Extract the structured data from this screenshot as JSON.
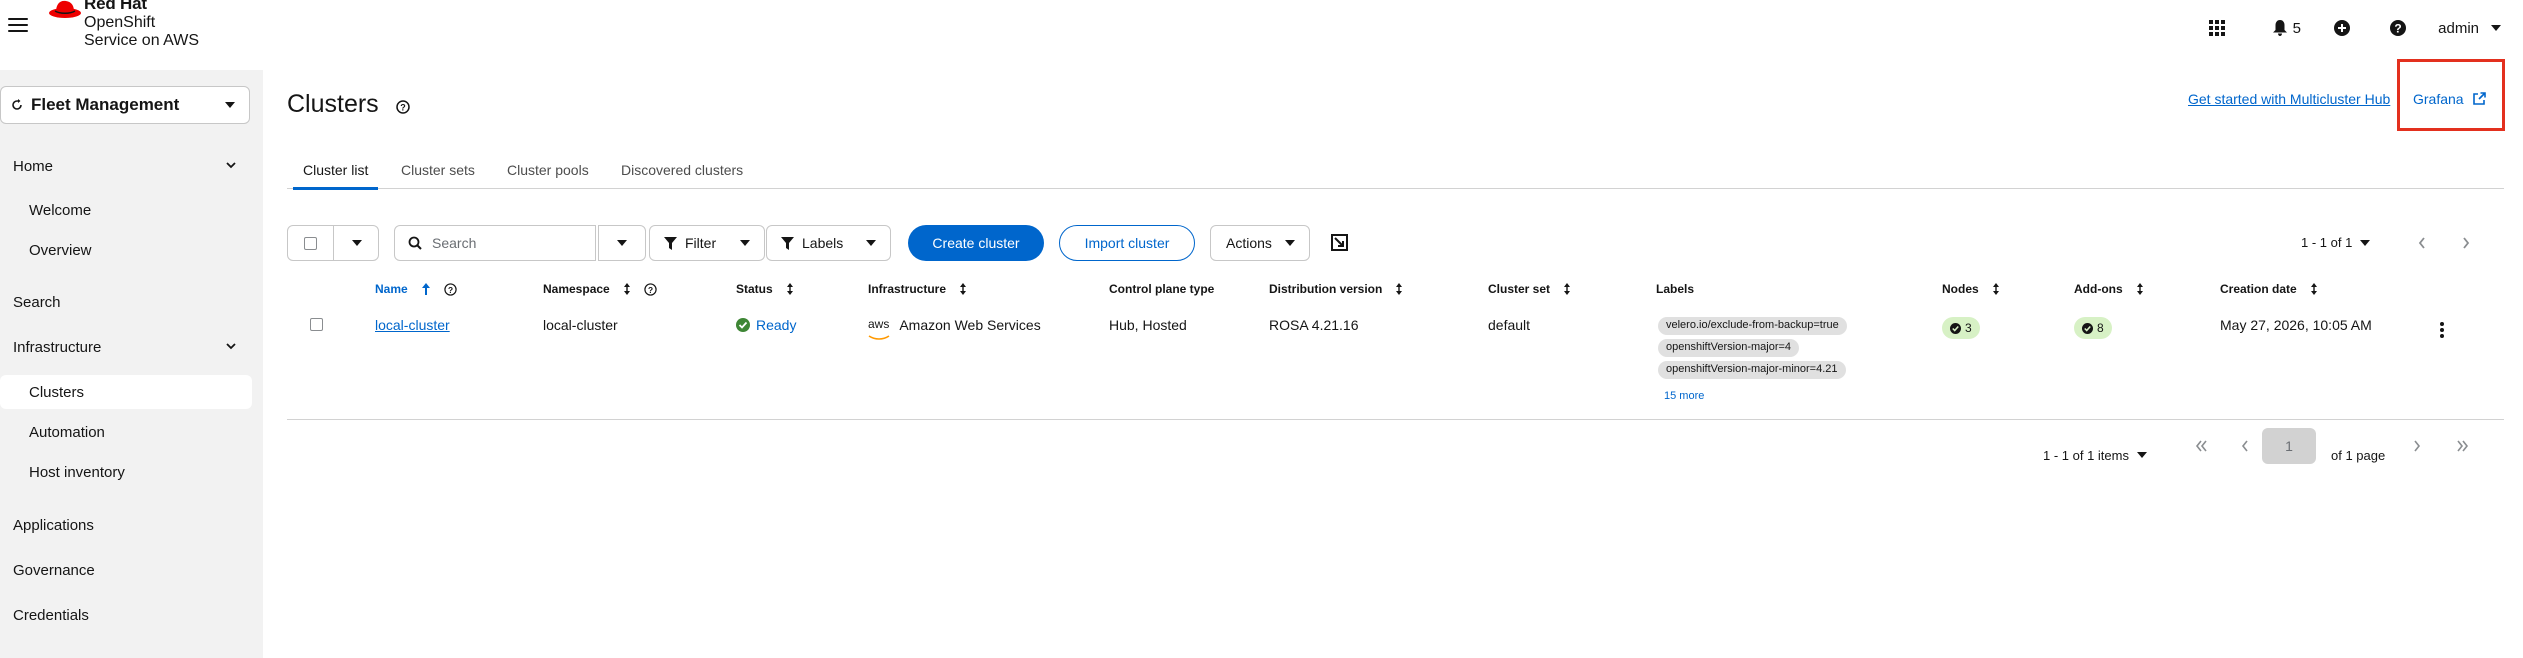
{
  "masthead": {
    "brand": "Red Hat",
    "product_line1": "OpenShift",
    "product_line2": "Service on AWS",
    "notifications_count": "5",
    "user": "admin",
    "icons": [
      "menu-icon",
      "app-launcher-icon",
      "bell-icon",
      "plus-circle-icon",
      "help-icon",
      "caret-down-icon"
    ]
  },
  "sidebar": {
    "perspective": "Fleet Management",
    "items": [
      {
        "label": "Home"
      },
      {
        "label": "Welcome"
      },
      {
        "label": "Overview"
      },
      {
        "label": "Search"
      },
      {
        "label": "Infrastructure"
      },
      {
        "label": "Clusters"
      },
      {
        "label": "Automation"
      },
      {
        "label": "Host inventory"
      },
      {
        "label": "Applications"
      },
      {
        "label": "Governance"
      },
      {
        "label": "Credentials"
      }
    ]
  },
  "page": {
    "title": "Clusters",
    "hub_link": "Get started with Multicluster Hub",
    "grafana_link": "Grafana",
    "highlight_color": "#e3301e"
  },
  "tabs": [
    "Cluster list",
    "Cluster sets",
    "Cluster pools",
    "Discovered clusters"
  ],
  "toolbar": {
    "search_placeholder": "Search",
    "filter_label": "Filter",
    "labels_label": "Labels",
    "create_label": "Create cluster",
    "import_label": "Import cluster",
    "actions_label": "Actions",
    "pagination": "1 - 1 of 1"
  },
  "table": {
    "columns": [
      "Name",
      "Namespace",
      "Status",
      "Infrastructure",
      "Control plane type",
      "Distribution version",
      "Cluster set",
      "Labels",
      "Nodes",
      "Add-ons",
      "Creation date"
    ],
    "rows": [
      {
        "name": "local-cluster",
        "namespace": "local-cluster",
        "status": "Ready",
        "infrastructure_logo": "aws",
        "infrastructure": "Amazon Web Services",
        "control_plane": "Hub, Hosted",
        "distribution": "ROSA 4.21.16",
        "cluster_set": "default",
        "labels": [
          "velero.io/exclude-from-backup=true",
          "openshiftVersion-major=4",
          "openshiftVersion-major-minor=4.21"
        ],
        "more_labels": "15 more",
        "nodes": "3",
        "addons": "8",
        "created": "May 27, 2026, 10:05 AM"
      }
    ]
  },
  "footer_pagination": {
    "items": "1 - 1 of 1 items",
    "page": "1",
    "of_pages": "of 1 page"
  }
}
